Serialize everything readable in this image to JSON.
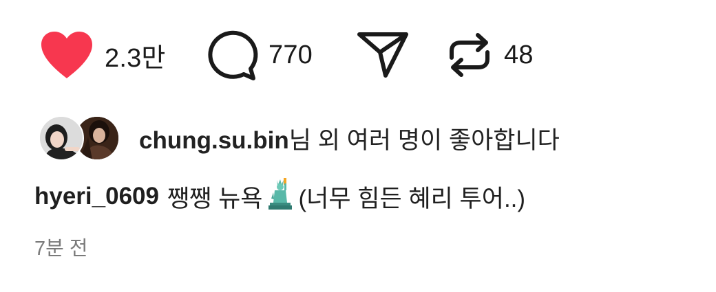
{
  "actions": {
    "like_count": "2.3만",
    "comment_count": "770",
    "repost_count": "48",
    "like_color": "#f7374f"
  },
  "liked_by": {
    "username": "chung.su.bin",
    "suffix": "님 외 여러 명이 좋아합니다"
  },
  "caption": {
    "username": "hyeri_0609",
    "text_before": "쨍쨍 뉴욕",
    "emoji": "statue-of-liberty",
    "text_after": "(너무 힘든 혜리 투어..)"
  },
  "timestamp": "7분 전"
}
